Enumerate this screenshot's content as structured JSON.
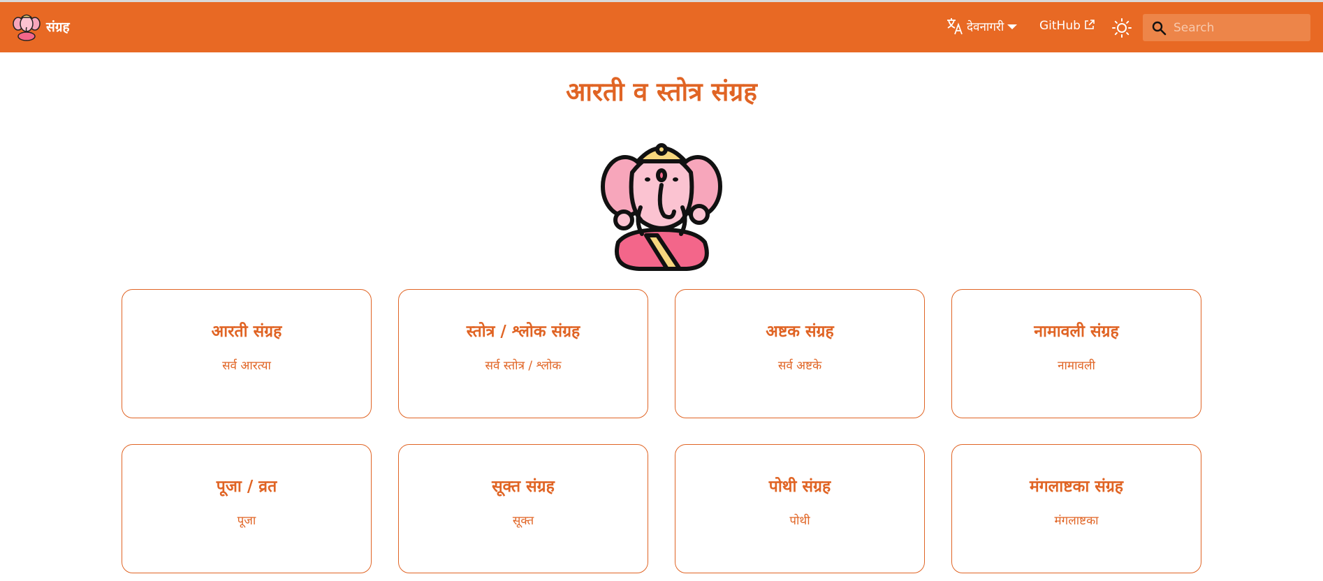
{
  "header": {
    "brand_name": "संग्रह",
    "language_label": "देवनागरी",
    "github_label": "GitHub",
    "search_placeholder": "Search",
    "bar_color": "#e86924"
  },
  "hero": {
    "title": "आरती व स्तोत्र संग्रह"
  },
  "cards": [
    {
      "title": "आरती संग्रह",
      "subtitle": "सर्व आरत्या"
    },
    {
      "title": "स्तोत्र / श्लोक संग्रह",
      "subtitle": "सर्व स्तोत्र / श्लोक"
    },
    {
      "title": "अष्टक संग्रह",
      "subtitle": "सर्व अष्टके"
    },
    {
      "title": "नामावली संग्रह",
      "subtitle": "नामावली"
    },
    {
      "title": "पूजा / व्रत",
      "subtitle": "पूजा"
    },
    {
      "title": "सूक्त संग्रह",
      "subtitle": "सूक्त"
    },
    {
      "title": "पोथी संग्रह",
      "subtitle": "पोथी"
    },
    {
      "title": "मंगलाष्टका संग्रह",
      "subtitle": "मंगलाष्टका"
    }
  ],
  "icons": {
    "logo": "ganesha-logo-icon",
    "language": "translate-icon",
    "external": "external-link-icon",
    "theme": "sun-icon",
    "search": "search-icon"
  }
}
